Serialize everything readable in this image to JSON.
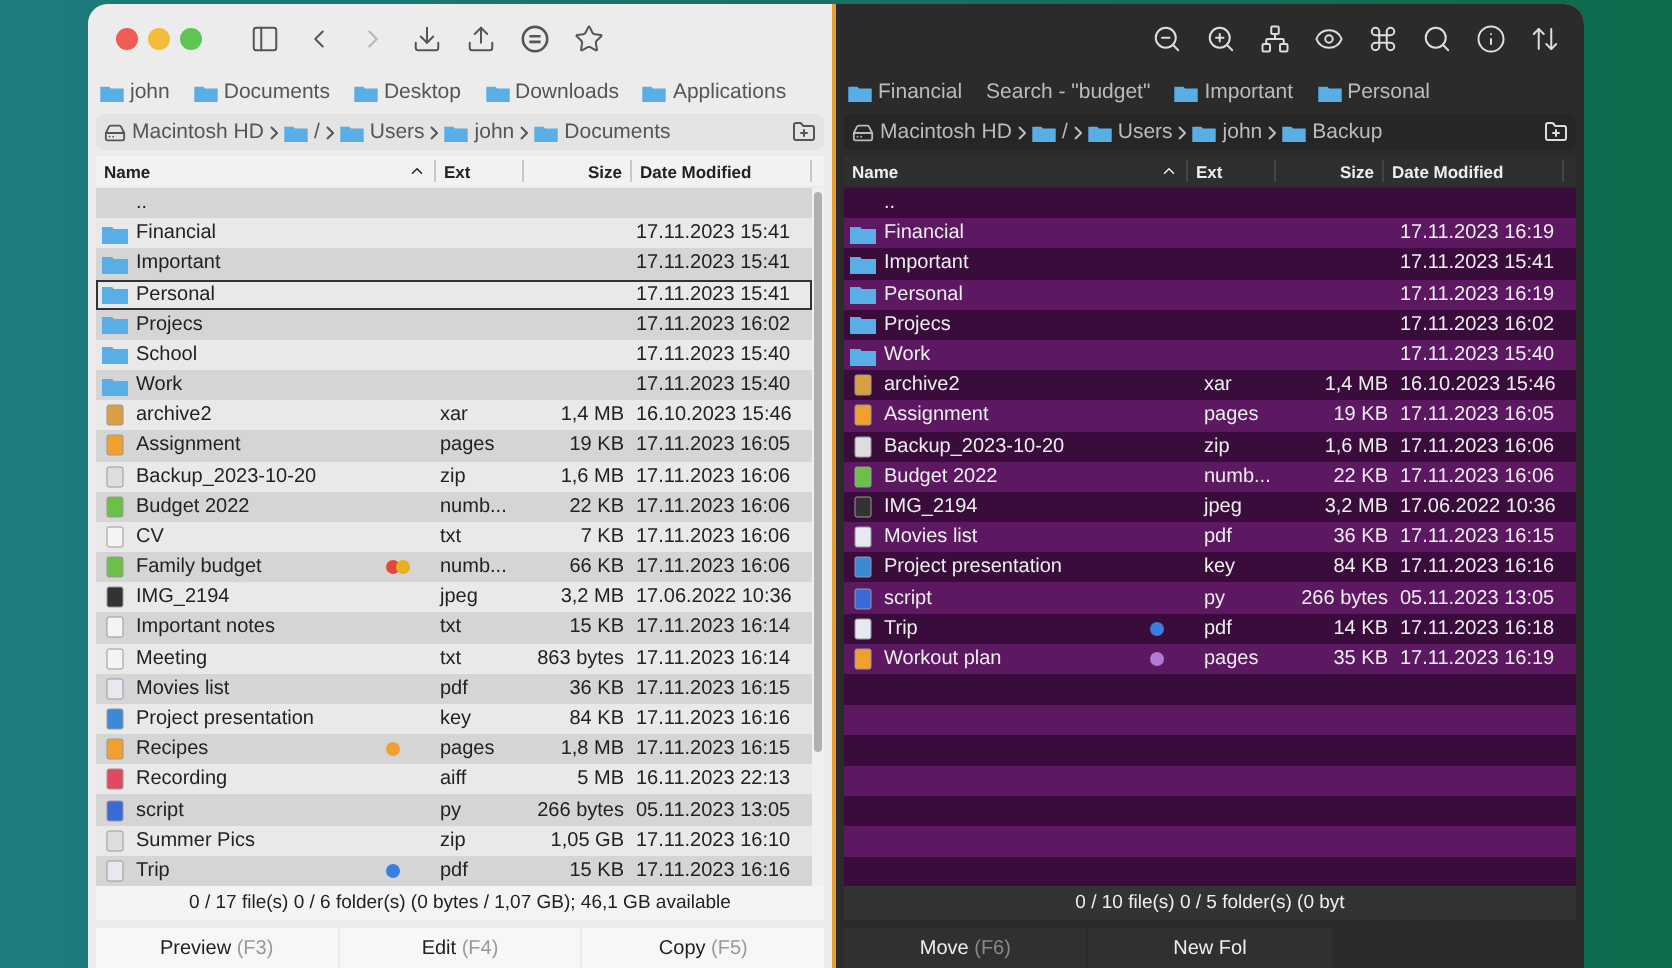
{
  "panes": [
    {
      "kind": "light",
      "forward_disabled": true,
      "favorites": [
        {
          "label": "john",
          "kind": "folder"
        },
        {
          "label": "Documents",
          "kind": "folder"
        },
        {
          "label": "Desktop",
          "kind": "folder"
        },
        {
          "label": "Downloads",
          "kind": "folder"
        },
        {
          "label": "Applications",
          "kind": "folder"
        }
      ],
      "path": [
        {
          "label": "Macintosh HD",
          "kind": "disk"
        },
        {
          "label": "/",
          "kind": "folder"
        },
        {
          "label": "Users",
          "kind": "folder"
        },
        {
          "label": "john",
          "kind": "folder"
        },
        {
          "label": "Documents",
          "kind": "folder"
        }
      ],
      "columns": [
        {
          "label": "Name",
          "sorted": true
        },
        {
          "label": "Ext",
          "sorted": false
        },
        {
          "label": "Size",
          "sorted": false
        },
        {
          "label": "Date Modified",
          "sorted": false
        }
      ],
      "rows": [
        {
          "name": "..",
          "kind": "parent",
          "focused": false
        },
        {
          "name": "Financial",
          "kind": "folder",
          "date": "17.11.2023 15:41",
          "focused": false
        },
        {
          "name": "Important",
          "kind": "folder",
          "date": "17.11.2023 15:41",
          "focused": false
        },
        {
          "name": "Personal",
          "kind": "folder",
          "date": "17.11.2023 15:41",
          "focused": true
        },
        {
          "name": "Projecs",
          "kind": "folder",
          "date": "17.11.2023 16:02",
          "focused": false
        },
        {
          "name": "School",
          "kind": "folder",
          "date": "17.11.2023 15:40",
          "focused": false
        },
        {
          "name": "Work",
          "kind": "folder",
          "date": "17.11.2023 15:40",
          "focused": false
        },
        {
          "name": "archive2",
          "kind": "archive",
          "ext": "xar",
          "size": "1,4 MB",
          "date": "16.10.2023 15:46",
          "focused": false
        },
        {
          "name": "Assignment",
          "kind": "pages",
          "ext": "pages",
          "size": "19 KB",
          "date": "17.11.2023 16:05",
          "focused": false
        },
        {
          "name": "Backup_2023-10-20",
          "kind": "zip",
          "ext": "zip",
          "size": "1,6 MB",
          "date": "17.11.2023 16:06",
          "focused": false
        },
        {
          "name": "Budget 2022",
          "kind": "numbers",
          "ext": "numb...",
          "size": "22 KB",
          "date": "17.11.2023 16:06",
          "focused": false
        },
        {
          "name": "CV",
          "kind": "text",
          "ext": "txt",
          "size": "7 KB",
          "date": "17.11.2023 16:06",
          "focused": false
        },
        {
          "name": "Family budget",
          "kind": "numbers",
          "ext": "numb...",
          "size": "66 KB",
          "date": "17.11.2023 16:06",
          "focused": false,
          "tags": [
            {
              "color": "#e04a3a"
            },
            {
              "color": "#e8b020"
            }
          ]
        },
        {
          "name": "IMG_2194",
          "kind": "image",
          "ext": "jpeg",
          "size": "3,2 MB",
          "date": "17.06.2022 10:36",
          "focused": false
        },
        {
          "name": "Important notes",
          "kind": "text",
          "ext": "txt",
          "size": "15 KB",
          "date": "17.11.2023 16:14",
          "focused": false
        },
        {
          "name": "Meeting",
          "kind": "text",
          "ext": "txt",
          "size": "863 bytes",
          "date": "17.11.2023 16:14",
          "focused": false
        },
        {
          "name": "Movies list",
          "kind": "pdf",
          "ext": "pdf",
          "size": "36 KB",
          "date": "17.11.2023 16:15",
          "focused": false
        },
        {
          "name": "Project presentation",
          "kind": "key",
          "ext": "key",
          "size": "84 KB",
          "date": "17.11.2023 16:16",
          "focused": false
        },
        {
          "name": "Recipes",
          "kind": "pages",
          "ext": "pages",
          "size": "1,8 MB",
          "date": "17.11.2023 16:15",
          "focused": false,
          "tags": [
            {
              "color": "#f0a030"
            }
          ]
        },
        {
          "name": "Recording",
          "kind": "audio",
          "ext": "aiff",
          "size": "5 MB",
          "date": "16.11.2023 22:13",
          "focused": false
        },
        {
          "name": "script",
          "kind": "python",
          "ext": "py",
          "size": "266 bytes",
          "date": "05.11.2023 13:05",
          "focused": false
        },
        {
          "name": "Summer Pics",
          "kind": "zip",
          "ext": "zip",
          "size": "1,05 GB",
          "date": "17.11.2023 16:10",
          "focused": false
        },
        {
          "name": "Trip",
          "kind": "pdf",
          "ext": "pdf",
          "size": "15 KB",
          "date": "17.11.2023 16:16",
          "focused": false,
          "tags": [
            {
              "color": "#3a7ee0"
            }
          ]
        }
      ],
      "status": "0 / 17 file(s) 0 / 6 folder(s) (0 bytes / 1,07 GB); 46,1 GB available",
      "buttons": [
        {
          "label": "Preview",
          "key": "(F3)"
        },
        {
          "label": "Edit",
          "key": "(F4)"
        },
        {
          "label": "Copy",
          "key": "(F5)"
        }
      ]
    },
    {
      "kind": "dark",
      "favorites": [
        {
          "label": "Financial",
          "kind": "folder"
        },
        {
          "label": "Search - \"budget\"",
          "kind": "search"
        },
        {
          "label": "Important",
          "kind": "folder"
        },
        {
          "label": "Personal",
          "kind": "folder"
        }
      ],
      "path": [
        {
          "label": "Macintosh HD",
          "kind": "disk"
        },
        {
          "label": "/",
          "kind": "folder"
        },
        {
          "label": "Users",
          "kind": "folder"
        },
        {
          "label": "john",
          "kind": "folder"
        },
        {
          "label": "Backup",
          "kind": "folder"
        }
      ],
      "columns": [
        {
          "label": "Name",
          "sorted": true
        },
        {
          "label": "Ext",
          "sorted": false
        },
        {
          "label": "Size",
          "sorted": false
        },
        {
          "label": "Date Modified",
          "sorted": false
        }
      ],
      "rows": [
        {
          "name": "..",
          "kind": "parent",
          "focused": false
        },
        {
          "name": "Financial",
          "kind": "folder",
          "date": "17.11.2023 16:19",
          "focused": false
        },
        {
          "name": "Important",
          "kind": "folder",
          "date": "17.11.2023 15:41",
          "focused": false
        },
        {
          "name": "Personal",
          "kind": "folder",
          "date": "17.11.2023 16:19",
          "focused": false
        },
        {
          "name": "Projecs",
          "kind": "folder",
          "date": "17.11.2023 16:02",
          "focused": false
        },
        {
          "name": "Work",
          "kind": "folder",
          "date": "17.11.2023 15:40",
          "focused": false
        },
        {
          "name": "archive2",
          "kind": "archive",
          "ext": "xar",
          "size": "1,4 MB",
          "date": "16.10.2023 15:46",
          "focused": false
        },
        {
          "name": "Assignment",
          "kind": "pages",
          "ext": "pages",
          "size": "19 KB",
          "date": "17.11.2023 16:05",
          "focused": false
        },
        {
          "name": "Backup_2023-10-20",
          "kind": "zip",
          "ext": "zip",
          "size": "1,6 MB",
          "date": "17.11.2023 16:06",
          "focused": false
        },
        {
          "name": "Budget 2022",
          "kind": "numbers",
          "ext": "numb...",
          "size": "22 KB",
          "date": "17.11.2023 16:06",
          "focused": false
        },
        {
          "name": "IMG_2194",
          "kind": "image",
          "ext": "jpeg",
          "size": "3,2 MB",
          "date": "17.06.2022 10:36",
          "focused": false
        },
        {
          "name": "Movies list",
          "kind": "pdf",
          "ext": "pdf",
          "size": "36 KB",
          "date": "17.11.2023 16:15",
          "focused": false
        },
        {
          "name": "Project presentation",
          "kind": "key",
          "ext": "key",
          "size": "84 KB",
          "date": "17.11.2023 16:16",
          "focused": false
        },
        {
          "name": "script",
          "kind": "python",
          "ext": "py",
          "size": "266 bytes",
          "date": "05.11.2023 13:05",
          "focused": false
        },
        {
          "name": "Trip",
          "kind": "pdf",
          "ext": "pdf",
          "size": "14 KB",
          "date": "17.11.2023 16:18",
          "focused": false,
          "tags": [
            {
              "color": "#3a7ee0"
            }
          ]
        },
        {
          "name": "Workout plan",
          "kind": "pages",
          "ext": "pages",
          "size": "35 KB",
          "date": "17.11.2023 16:19",
          "focused": false,
          "tags": [
            {
              "color": "#b07ad8"
            }
          ]
        }
      ],
      "status": "0 / 10 file(s) 0 / 5 folder(s) (0 byt",
      "buttons": [
        {
          "label": "Move",
          "key": "(F6)"
        },
        {
          "label": "New Fol"
        }
      ]
    }
  ]
}
